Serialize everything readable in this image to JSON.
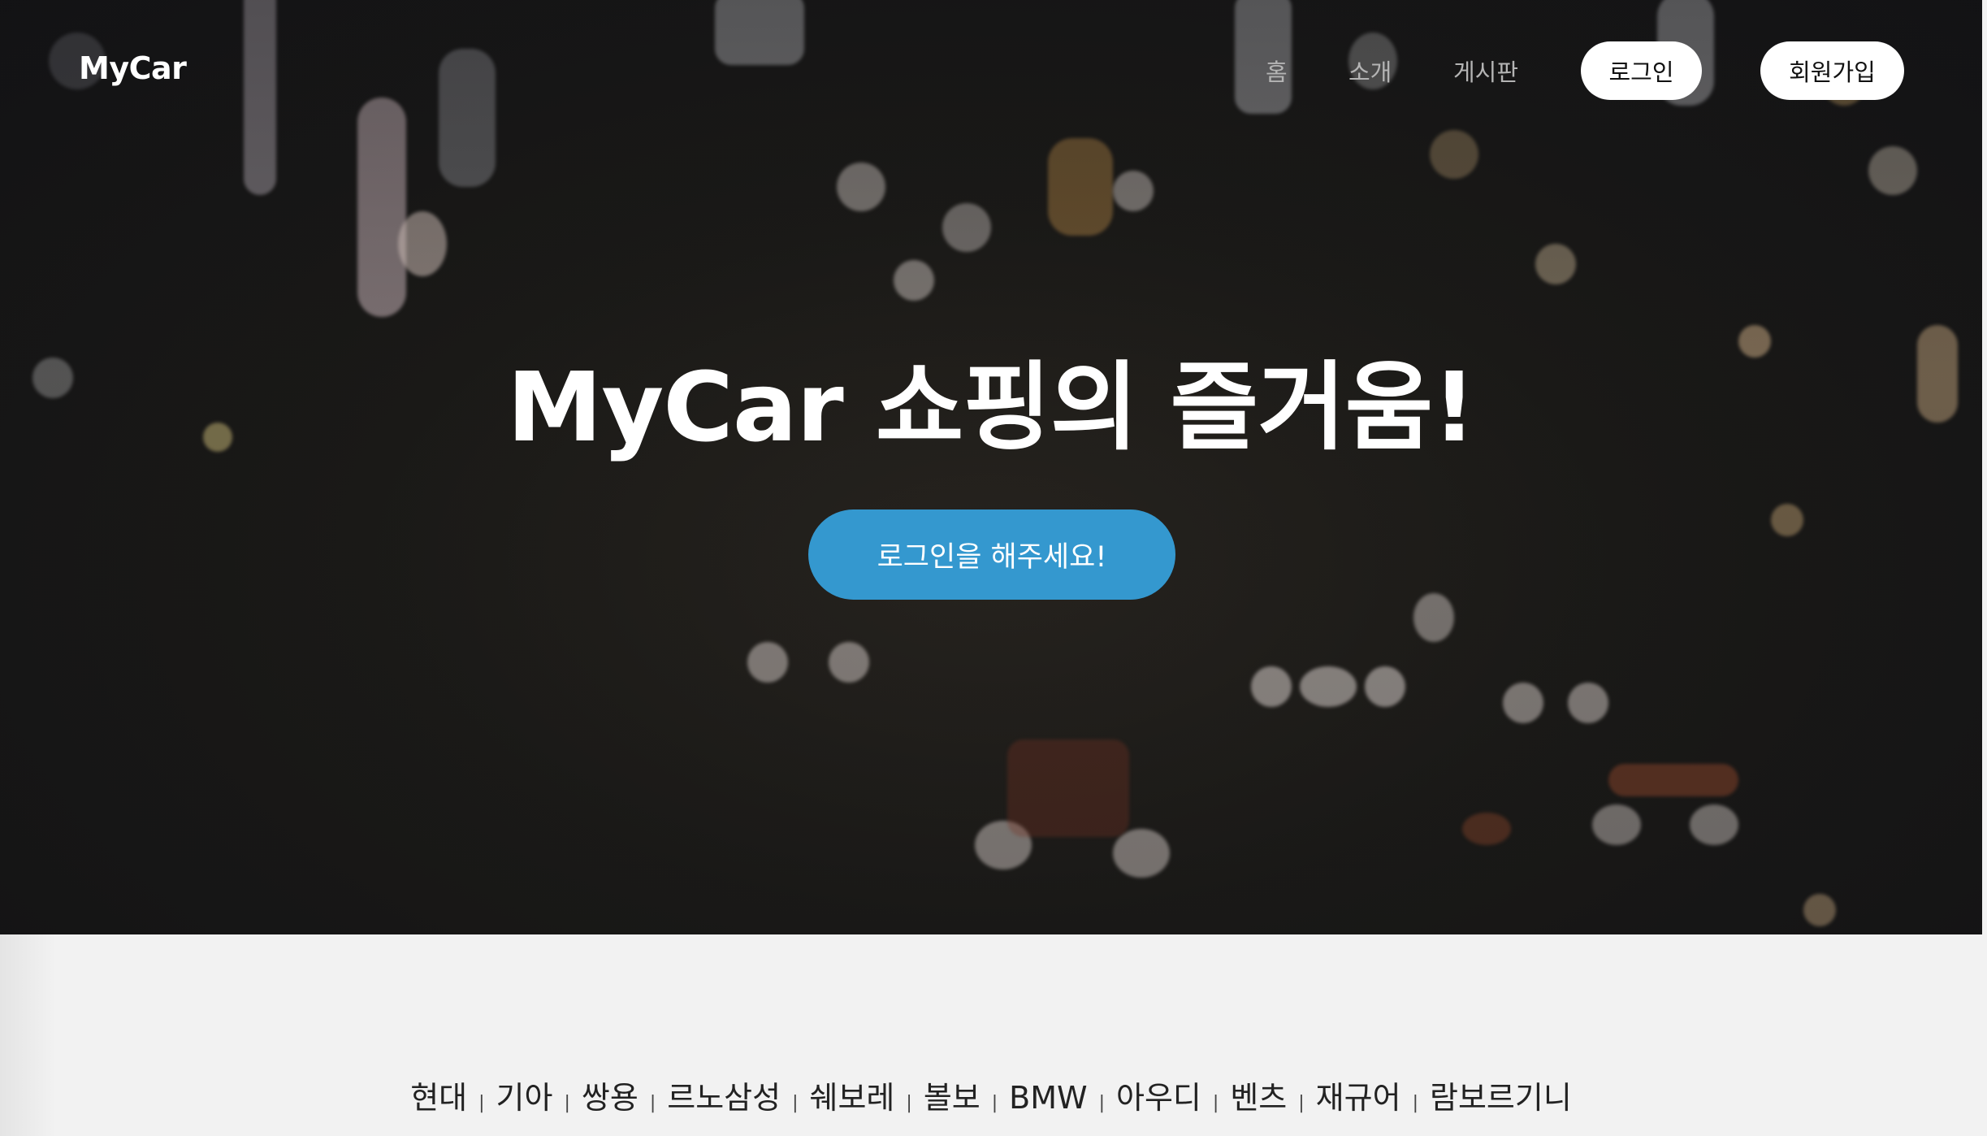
{
  "navbar": {
    "brand": "MyCar",
    "links": [
      "홈",
      "소개",
      "게시판"
    ],
    "login_label": "로그인",
    "signup_label": "회원가입"
  },
  "hero": {
    "title": "MyCar 쇼핑의 즐거움!",
    "cta_label": "로그인을 해주세요!"
  },
  "brands": [
    "현대",
    "기아",
    "쌍용",
    "르노삼성",
    "쉐보레",
    "볼보",
    "BMW",
    "아우디",
    "벤츠",
    "재규어",
    "람보르기니"
  ],
  "separator": "|",
  "colors": {
    "cta_blue": "#3498cf",
    "hero_dark": "#1b1a17",
    "footer_bg": "#f2f2f2"
  }
}
